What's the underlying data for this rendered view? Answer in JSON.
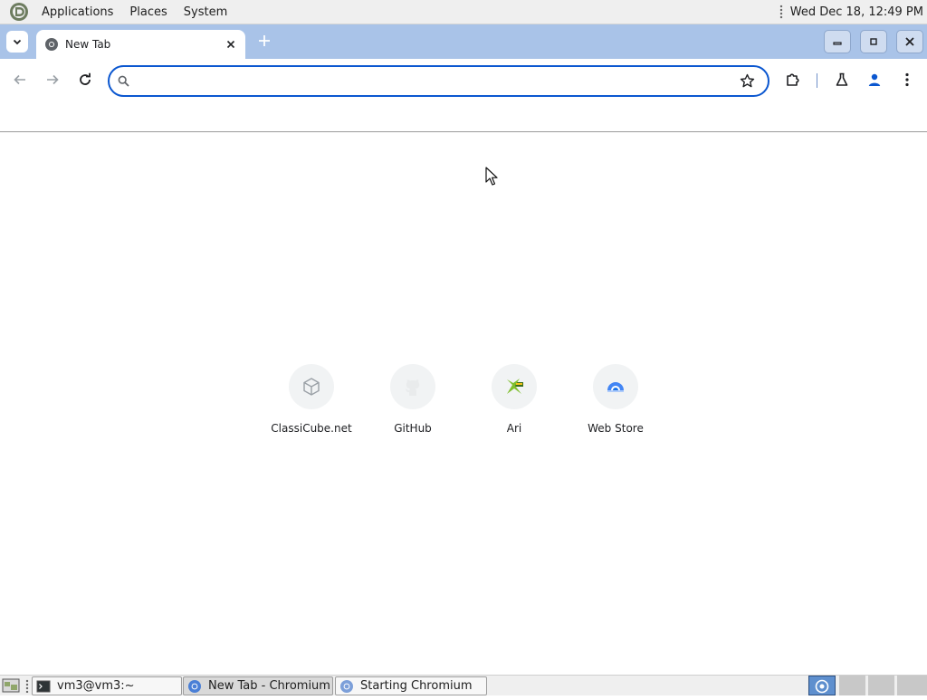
{
  "top_panel": {
    "menus": [
      "Applications",
      "Places",
      "System"
    ],
    "clock": "Wed Dec 18, 12:49 PM"
  },
  "browser": {
    "tab": {
      "title": "New Tab"
    },
    "omnibox": {
      "value": "",
      "placeholder": ""
    }
  },
  "shortcuts": [
    {
      "label": "ClassiCube.net",
      "icon": "cube-icon"
    },
    {
      "label": "GitHub",
      "icon": "github-icon"
    },
    {
      "label": "Ari",
      "icon": "ari-icon"
    },
    {
      "label": "Web Store",
      "icon": "web-store-icon"
    }
  ],
  "taskbar": {
    "items": [
      {
        "label": "vm3@vm3:~",
        "icon": "terminal-icon"
      },
      {
        "label": "New Tab - Chromium",
        "icon": "chromium-icon"
      },
      {
        "label": "Starting Chromium",
        "icon": "chromium-icon"
      }
    ]
  },
  "colors": {
    "tabstrip": "#a9c3e8",
    "omnibox_border": "#0b57d0",
    "panel": "#efefef"
  }
}
